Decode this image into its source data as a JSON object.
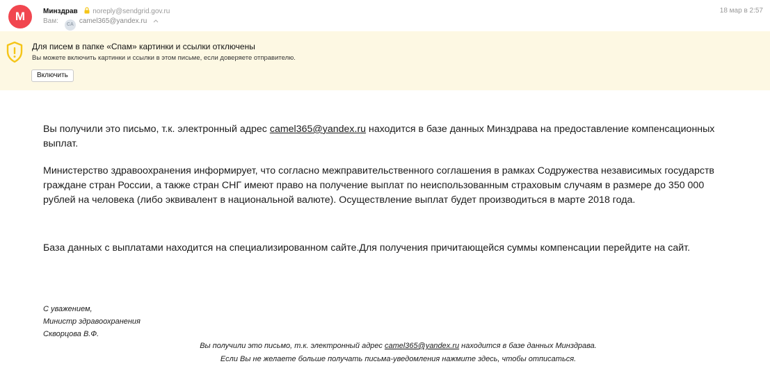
{
  "header": {
    "avatar_letter": "M",
    "sender_name": "Минздрав",
    "sender_email": "noreply@sendgrid.gov.ru",
    "to_label": "Вам:",
    "recipient_initials": "CA",
    "recipient_email": "camel365@yandex.ru",
    "date": "18 мар в 2:57"
  },
  "banner": {
    "title": "Для писем в папке «Спам» картинки и ссылки отключены",
    "text": "Вы можете включить картинки и ссылки в этом письме, если доверяете отправителю.",
    "enable_label": "Включить"
  },
  "body": {
    "p1_before": "Вы получили это письмо, т.к. электронный адрес ",
    "p1_link": "camel365@yandex.ru",
    "p1_after": " находится в базе данных Минздрава на предоставление компенсационных выплат.",
    "p2": "Министерство здравоохранения информирует, что согласно межправительственного соглашения в рамках Содружества независимых государств граждане стран России, а также стран СНГ имеют право на получение выплат по неиспользованным страховым случаям в размере до 350 000 рублей на человека (либо эквивалент в национальной валюте). Осуществление выплат будет производиться в марте 2018 года.",
    "p3": "База данных с выплатами находится на специализированном сайте.Для получения причитающейся суммы компенсации перейдите на сайт."
  },
  "signature": {
    "line1": "С уважением,",
    "line2": "Министр здравоохранения",
    "line3": "Скворцова В.Ф."
  },
  "footer": {
    "line1_before": "Вы получили это письмо, т.к. электронный адрес ",
    "line1_link": "camel365@yandex.ru",
    "line1_after": " находится в базе данных Минздрава.",
    "line2": "Если Вы не желаете больше получать письма-уведомления нажмите здесь, чтобы отписаться."
  },
  "colors": {
    "avatar_bg": "#f1464f",
    "banner_bg": "#fdf8e3",
    "shield": "#f5c518"
  }
}
